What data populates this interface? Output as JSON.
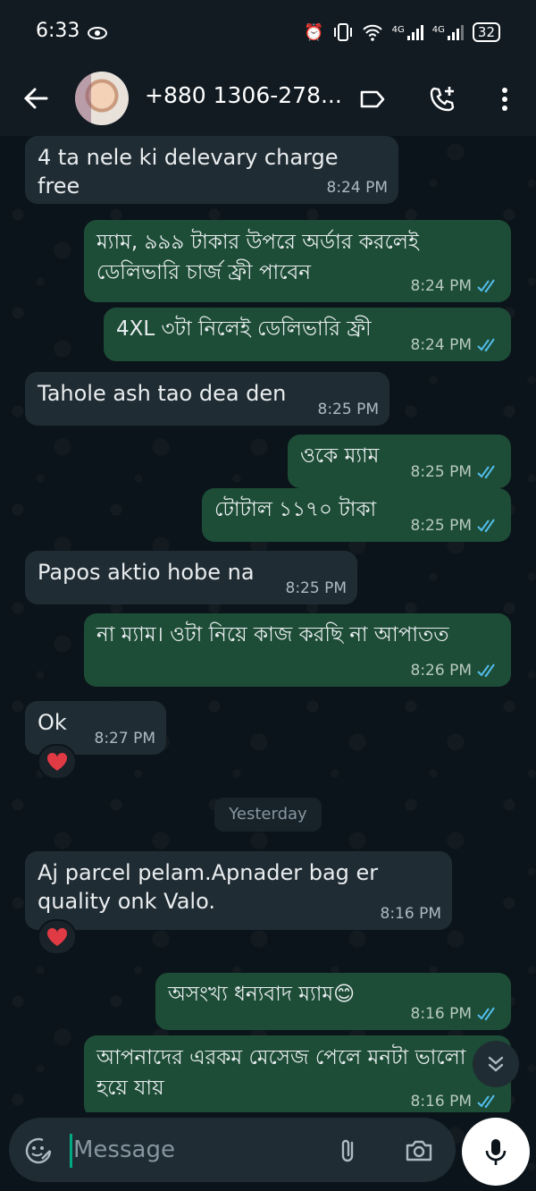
{
  "status_bar": {
    "time": "6:33",
    "network_1": "4G",
    "network_2": "4G",
    "battery": "32"
  },
  "header": {
    "contact_name": "+880 1306-278..."
  },
  "messages": [
    {
      "dir": "in",
      "text": "4 ta nele ki delevary charge free",
      "time": "8:24 PM"
    },
    {
      "dir": "out",
      "text": "ম্যাম, ৯৯৯ টাকার উপরে অর্ডার করলেই ডেলিভারি চার্জ ফ্রী পাবেন",
      "time": "8:24 PM"
    },
    {
      "dir": "out",
      "text": "4XL ৩টা নিলেই ডেলিভারি ফ্রী",
      "time": "8:24 PM"
    },
    {
      "dir": "in",
      "text": "Tahole ash tao dea den",
      "time": "8:25 PM"
    },
    {
      "dir": "out",
      "text": "ওকে ম্যাম",
      "time": "8:25 PM"
    },
    {
      "dir": "out",
      "text": "টোটাল ১১৭০ টাকা",
      "time": "8:25 PM"
    },
    {
      "dir": "in",
      "text": "Papos aktio hobe na",
      "time": "8:25 PM"
    },
    {
      "dir": "out",
      "text": "না ম্যাম। ওটা নিয়ে কাজ করছি না আপাতত",
      "time": "8:26 PM"
    },
    {
      "dir": "in",
      "text": "Ok",
      "time": "8:27 PM",
      "reaction": "heart"
    },
    {
      "dir": "in",
      "text": "Aj parcel pelam.Apnader bag er quality onk Valo.",
      "time": "8:16 PM",
      "reaction": "heart"
    },
    {
      "dir": "out",
      "text": "অসংখ্য ধন্যবাদ ম্যাম😊",
      "time": "8:16 PM"
    },
    {
      "dir": "out",
      "text": "আপনাদের এরকম মেসেজ পেলে মনটা ভালো হয়ে যায়",
      "time": "8:16 PM"
    }
  ],
  "day_divider": "Yesterday",
  "composer": {
    "placeholder": "Message"
  },
  "colors": {
    "background": "#0b141a",
    "incoming_bubble": "#202c33",
    "outgoing_bubble": "#1d4d37",
    "read_ticks": "#53bdeb"
  }
}
